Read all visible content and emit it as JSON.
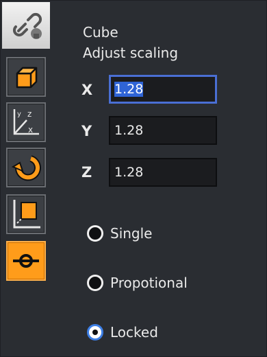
{
  "toolbar": {
    "items": [
      {
        "name": "link-tool",
        "icon": "chain-link-icon",
        "state": "header"
      },
      {
        "name": "object-tool",
        "icon": "cube-icon",
        "state": "normal"
      },
      {
        "name": "axes-tool",
        "icon": "xyz-axes-icon",
        "state": "normal"
      },
      {
        "name": "rotate-tool",
        "icon": "rotate-arrow-icon",
        "state": "normal"
      },
      {
        "name": "scale-tool",
        "icon": "scale-icon",
        "state": "normal"
      },
      {
        "name": "constraint-tool",
        "icon": "locked-constraint-icon",
        "state": "active"
      }
    ],
    "axes_icon_letters": {
      "y": "y",
      "z": "z",
      "x": "x"
    }
  },
  "panel": {
    "object_name": "Cube",
    "mode_label": "Adjust scaling",
    "fields": [
      {
        "axis": "X",
        "value": "1.28",
        "focused": true
      },
      {
        "axis": "Y",
        "value": "1.28",
        "focused": false
      },
      {
        "axis": "Z",
        "value": "1.28",
        "focused": false
      }
    ],
    "options": [
      {
        "label": "Single",
        "checked": false
      },
      {
        "label": "Propotional",
        "checked": false
      },
      {
        "label": "Locked",
        "checked": true
      }
    ]
  },
  "colors": {
    "background": "#2a2d32",
    "accent": "#ff9c1a",
    "focus_border": "#4a6fd4",
    "selection": "#2f64d6",
    "radio_checked_ring": "#3d7fe6"
  }
}
